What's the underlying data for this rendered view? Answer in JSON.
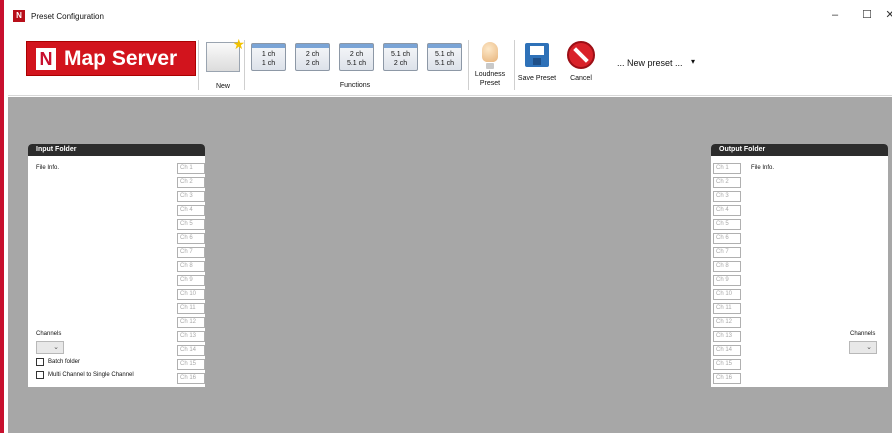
{
  "window": {
    "title": "Preset Configuration",
    "app_icon": "app-logo-icon",
    "minimize": "–",
    "maximize": "☐",
    "close": "✕"
  },
  "logo": {
    "letter": "N",
    "text": "Map Server"
  },
  "toolbar": {
    "new_label": "New",
    "functions_label": "Functions",
    "functions": [
      {
        "top": "1 ch",
        "bottom": "1 ch"
      },
      {
        "top": "2 ch",
        "bottom": "2 ch"
      },
      {
        "top": "2 ch",
        "bottom": "5.1 ch"
      },
      {
        "top": "5.1 ch",
        "bottom": "2 ch"
      },
      {
        "top": "5.1 ch",
        "bottom": "5.1 ch"
      }
    ],
    "loudness_label_1": "Loudness",
    "loudness_label_2": "Preset",
    "save_label": "Save Preset",
    "cancel_label": "Cancel",
    "preset_select": "... New preset ...",
    "preset_arrow": "▾"
  },
  "input_panel": {
    "title": "Input Folder",
    "file_info": "File Info.",
    "channels_label": "Channels",
    "channels_value": "",
    "batch_folder": "Batch folder",
    "multi_channel": "Multi Channel to Single Channel"
  },
  "output_panel": {
    "title": "Output Folder",
    "file_info": "File Info.",
    "channels_label": "Channels",
    "channels_value": ""
  },
  "channels": [
    "Ch 1",
    "Ch 2",
    "Ch 3",
    "Ch 4",
    "Ch 5",
    "Ch 6",
    "Ch 7",
    "Ch 8",
    "Ch 9",
    "Ch 10",
    "Ch 11",
    "Ch 12",
    "Ch 13",
    "Ch 14",
    "Ch 15",
    "Ch 16"
  ],
  "colors": {
    "brand_red": "#d2141d",
    "workspace": "#a7a7a7",
    "panel_header": "#2c2c2c"
  }
}
